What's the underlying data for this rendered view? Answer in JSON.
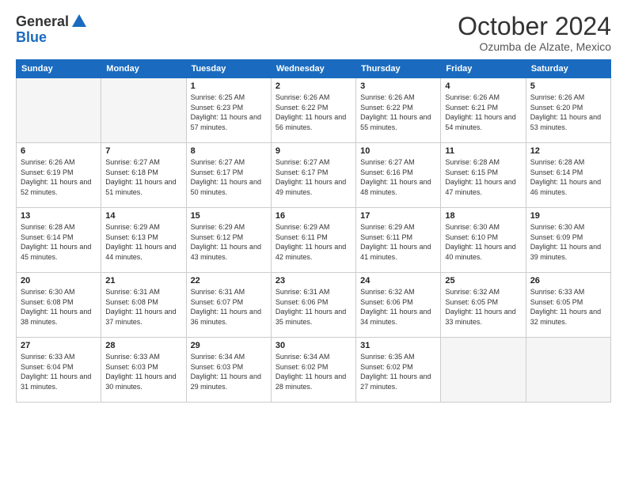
{
  "logo": {
    "general": "General",
    "blue": "Blue"
  },
  "title": "October 2024",
  "location": "Ozumba de Alzate, Mexico",
  "weekdays": [
    "Sunday",
    "Monday",
    "Tuesday",
    "Wednesday",
    "Thursday",
    "Friday",
    "Saturday"
  ],
  "weeks": [
    [
      {
        "day": "",
        "sunrise": "",
        "sunset": "",
        "daylight": ""
      },
      {
        "day": "",
        "sunrise": "",
        "sunset": "",
        "daylight": ""
      },
      {
        "day": "1",
        "sunrise": "Sunrise: 6:25 AM",
        "sunset": "Sunset: 6:23 PM",
        "daylight": "Daylight: 11 hours and 57 minutes."
      },
      {
        "day": "2",
        "sunrise": "Sunrise: 6:26 AM",
        "sunset": "Sunset: 6:22 PM",
        "daylight": "Daylight: 11 hours and 56 minutes."
      },
      {
        "day": "3",
        "sunrise": "Sunrise: 6:26 AM",
        "sunset": "Sunset: 6:22 PM",
        "daylight": "Daylight: 11 hours and 55 minutes."
      },
      {
        "day": "4",
        "sunrise": "Sunrise: 6:26 AM",
        "sunset": "Sunset: 6:21 PM",
        "daylight": "Daylight: 11 hours and 54 minutes."
      },
      {
        "day": "5",
        "sunrise": "Sunrise: 6:26 AM",
        "sunset": "Sunset: 6:20 PM",
        "daylight": "Daylight: 11 hours and 53 minutes."
      }
    ],
    [
      {
        "day": "6",
        "sunrise": "Sunrise: 6:26 AM",
        "sunset": "Sunset: 6:19 PM",
        "daylight": "Daylight: 11 hours and 52 minutes."
      },
      {
        "day": "7",
        "sunrise": "Sunrise: 6:27 AM",
        "sunset": "Sunset: 6:18 PM",
        "daylight": "Daylight: 11 hours and 51 minutes."
      },
      {
        "day": "8",
        "sunrise": "Sunrise: 6:27 AM",
        "sunset": "Sunset: 6:17 PM",
        "daylight": "Daylight: 11 hours and 50 minutes."
      },
      {
        "day": "9",
        "sunrise": "Sunrise: 6:27 AM",
        "sunset": "Sunset: 6:17 PM",
        "daylight": "Daylight: 11 hours and 49 minutes."
      },
      {
        "day": "10",
        "sunrise": "Sunrise: 6:27 AM",
        "sunset": "Sunset: 6:16 PM",
        "daylight": "Daylight: 11 hours and 48 minutes."
      },
      {
        "day": "11",
        "sunrise": "Sunrise: 6:28 AM",
        "sunset": "Sunset: 6:15 PM",
        "daylight": "Daylight: 11 hours and 47 minutes."
      },
      {
        "day": "12",
        "sunrise": "Sunrise: 6:28 AM",
        "sunset": "Sunset: 6:14 PM",
        "daylight": "Daylight: 11 hours and 46 minutes."
      }
    ],
    [
      {
        "day": "13",
        "sunrise": "Sunrise: 6:28 AM",
        "sunset": "Sunset: 6:14 PM",
        "daylight": "Daylight: 11 hours and 45 minutes."
      },
      {
        "day": "14",
        "sunrise": "Sunrise: 6:29 AM",
        "sunset": "Sunset: 6:13 PM",
        "daylight": "Daylight: 11 hours and 44 minutes."
      },
      {
        "day": "15",
        "sunrise": "Sunrise: 6:29 AM",
        "sunset": "Sunset: 6:12 PM",
        "daylight": "Daylight: 11 hours and 43 minutes."
      },
      {
        "day": "16",
        "sunrise": "Sunrise: 6:29 AM",
        "sunset": "Sunset: 6:11 PM",
        "daylight": "Daylight: 11 hours and 42 minutes."
      },
      {
        "day": "17",
        "sunrise": "Sunrise: 6:29 AM",
        "sunset": "Sunset: 6:11 PM",
        "daylight": "Daylight: 11 hours and 41 minutes."
      },
      {
        "day": "18",
        "sunrise": "Sunrise: 6:30 AM",
        "sunset": "Sunset: 6:10 PM",
        "daylight": "Daylight: 11 hours and 40 minutes."
      },
      {
        "day": "19",
        "sunrise": "Sunrise: 6:30 AM",
        "sunset": "Sunset: 6:09 PM",
        "daylight": "Daylight: 11 hours and 39 minutes."
      }
    ],
    [
      {
        "day": "20",
        "sunrise": "Sunrise: 6:30 AM",
        "sunset": "Sunset: 6:08 PM",
        "daylight": "Daylight: 11 hours and 38 minutes."
      },
      {
        "day": "21",
        "sunrise": "Sunrise: 6:31 AM",
        "sunset": "Sunset: 6:08 PM",
        "daylight": "Daylight: 11 hours and 37 minutes."
      },
      {
        "day": "22",
        "sunrise": "Sunrise: 6:31 AM",
        "sunset": "Sunset: 6:07 PM",
        "daylight": "Daylight: 11 hours and 36 minutes."
      },
      {
        "day": "23",
        "sunrise": "Sunrise: 6:31 AM",
        "sunset": "Sunset: 6:06 PM",
        "daylight": "Daylight: 11 hours and 35 minutes."
      },
      {
        "day": "24",
        "sunrise": "Sunrise: 6:32 AM",
        "sunset": "Sunset: 6:06 PM",
        "daylight": "Daylight: 11 hours and 34 minutes."
      },
      {
        "day": "25",
        "sunrise": "Sunrise: 6:32 AM",
        "sunset": "Sunset: 6:05 PM",
        "daylight": "Daylight: 11 hours and 33 minutes."
      },
      {
        "day": "26",
        "sunrise": "Sunrise: 6:33 AM",
        "sunset": "Sunset: 6:05 PM",
        "daylight": "Daylight: 11 hours and 32 minutes."
      }
    ],
    [
      {
        "day": "27",
        "sunrise": "Sunrise: 6:33 AM",
        "sunset": "Sunset: 6:04 PM",
        "daylight": "Daylight: 11 hours and 31 minutes."
      },
      {
        "day": "28",
        "sunrise": "Sunrise: 6:33 AM",
        "sunset": "Sunset: 6:03 PM",
        "daylight": "Daylight: 11 hours and 30 minutes."
      },
      {
        "day": "29",
        "sunrise": "Sunrise: 6:34 AM",
        "sunset": "Sunset: 6:03 PM",
        "daylight": "Daylight: 11 hours and 29 minutes."
      },
      {
        "day": "30",
        "sunrise": "Sunrise: 6:34 AM",
        "sunset": "Sunset: 6:02 PM",
        "daylight": "Daylight: 11 hours and 28 minutes."
      },
      {
        "day": "31",
        "sunrise": "Sunrise: 6:35 AM",
        "sunset": "Sunset: 6:02 PM",
        "daylight": "Daylight: 11 hours and 27 minutes."
      },
      {
        "day": "",
        "sunrise": "",
        "sunset": "",
        "daylight": ""
      },
      {
        "day": "",
        "sunrise": "",
        "sunset": "",
        "daylight": ""
      }
    ]
  ]
}
